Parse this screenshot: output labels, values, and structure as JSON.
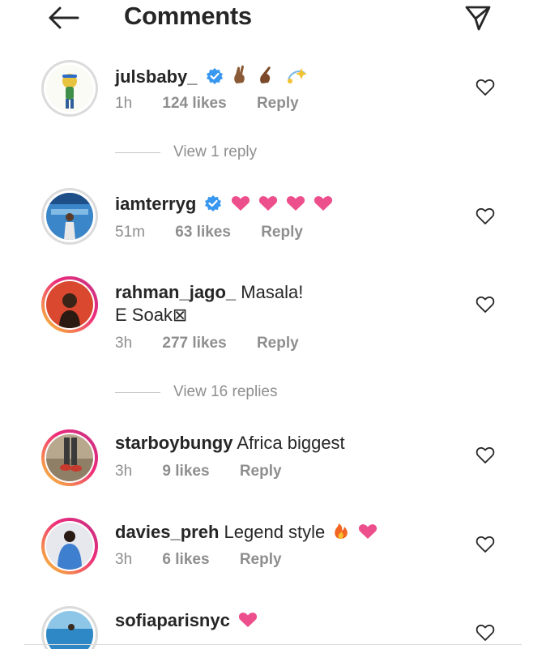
{
  "header": {
    "title": "Comments",
    "back_icon": "arrow-left-icon",
    "share_icon": "paper-plane-icon"
  },
  "comments": [
    {
      "username": "julsbaby_",
      "text": "",
      "time": "1h",
      "likes": "124 likes",
      "reply": "Reply",
      "verified": true,
      "view_replies": "View 1 reply"
    },
    {
      "username": "iamterryg",
      "text": "",
      "time": "51m",
      "likes": "63 likes",
      "reply": "Reply",
      "verified": true
    },
    {
      "username": "rahman_jago_",
      "text": "Masala!",
      "text2": "E Soak⊠",
      "time": "3h",
      "likes": "277 likes",
      "reply": "Reply",
      "view_replies": "View 16 replies"
    },
    {
      "username": "starboybungy",
      "text": "Africa biggest",
      "time": "3h",
      "likes": "9 likes",
      "reply": "Reply"
    },
    {
      "username": "davies_preh",
      "text": "Legend style",
      "time": "3h",
      "likes": "6 likes",
      "reply": "Reply"
    },
    {
      "username": "sofiaparisnyc",
      "text": ""
    }
  ],
  "colors": {
    "verified": "#3897f0",
    "heart_emoji": "#ed4e8c",
    "meta_text": "#8e8e8e"
  }
}
